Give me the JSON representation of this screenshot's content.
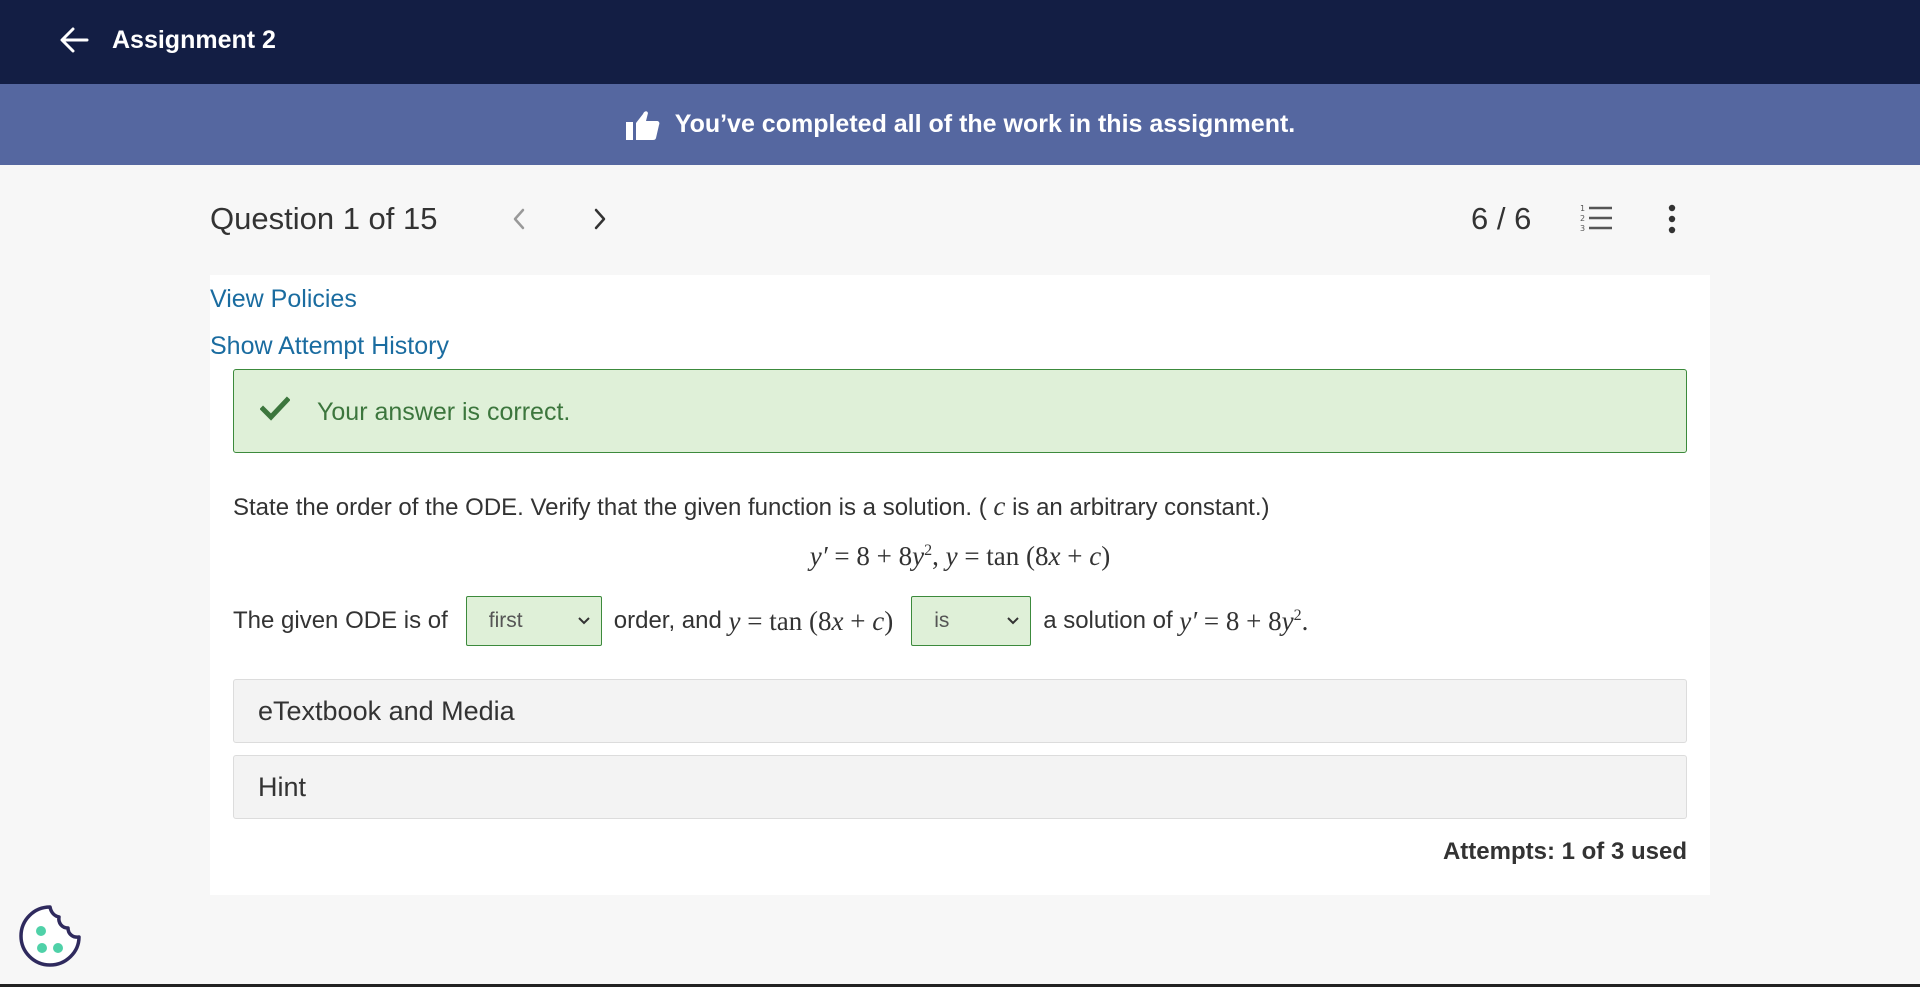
{
  "topbar": {
    "title": "Assignment 2",
    "back_icon": "arrow-left-icon",
    "background": "#131e44"
  },
  "banner": {
    "icon": "thumbs-up-icon",
    "text": "You’ve completed all of the work in this assignment.",
    "background": "#5567a0"
  },
  "question_header": {
    "title": "Question 1 of 15",
    "prev_icon": "chevron-left-icon",
    "next_icon": "chevron-right-icon",
    "score": "6 / 6",
    "list_icon": "numbered-list-icon",
    "more_icon": "more-vertical-icon"
  },
  "links": {
    "view_policies": "View Policies",
    "show_attempt_history": "Show Attempt History"
  },
  "feedback": {
    "icon": "checkmark-icon",
    "text": "Your answer is correct.",
    "color": "#3c763d",
    "background": "#dff0d8"
  },
  "question": {
    "prompt_before": "State the order of the ODE. Verify that the given function is a solution. (",
    "prompt_var": "c",
    "prompt_after": " is an arbitrary constant.)",
    "equation": {
      "lhs": "y′",
      "eq1": " = 8 + 8",
      "y": "y",
      "exp": "2",
      "sep": ",  ",
      "y2": "y",
      "eq2": " = tan (8",
      "x": "x",
      "plus": " + ",
      "c": "c",
      "close": ")"
    },
    "answer": {
      "text1": "The given ODE is of",
      "order_select": "first",
      "text2": "order, and",
      "y_func": "y",
      "func_rest": " = tan (8",
      "x": "x",
      "plus": " + ",
      "c": "c",
      "close": ")",
      "is_select": "is",
      "text3": "a solution of",
      "ode_lhs": "y′",
      "ode_rest": " = 8 + 8",
      "ode_y": "y",
      "ode_exp": "2",
      "period": "."
    }
  },
  "panels": {
    "etextbook": "eTextbook and Media",
    "hint": "Hint"
  },
  "attempts": "Attempts: 1 of 3 used",
  "cookie": {
    "icon": "cookie-icon"
  }
}
